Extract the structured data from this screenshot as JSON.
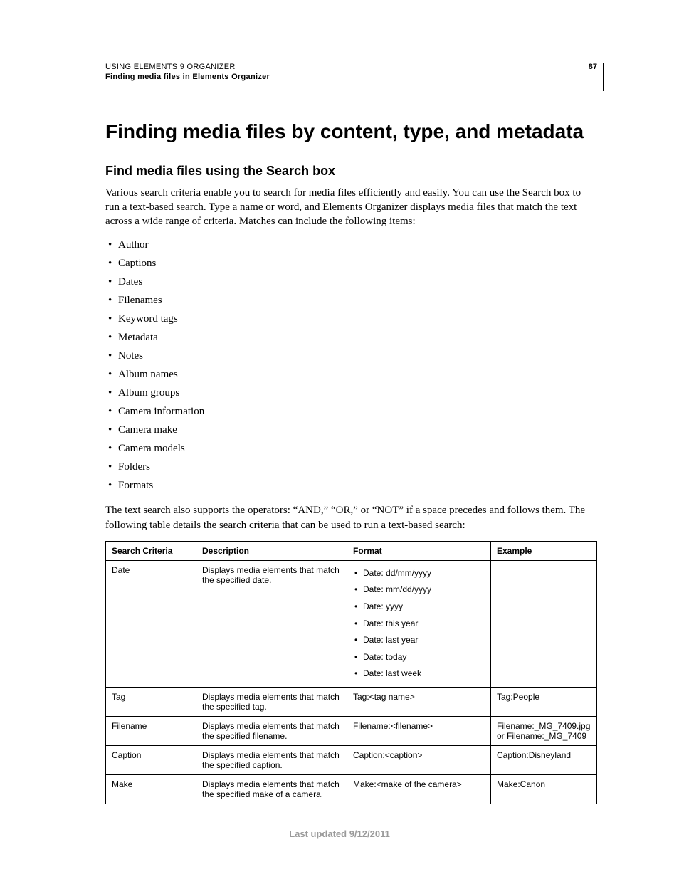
{
  "header": {
    "doc_title": "USING ELEMENTS 9 ORGANIZER",
    "section_path": "Finding media files in Elements Organizer",
    "page_number": "87"
  },
  "chapter_title": "Finding media files by content, type, and metadata",
  "section_title": "Find media files using the Search box",
  "intro_para": "Various search criteria enable you to search for media files efficiently and easily. You can use the Search box to run a text-based search. Type a name or word, and Elements Organizer displays media files that match the text across a wide range of criteria. Matches can include the following items:",
  "criteria_list": [
    "Author",
    "Captions",
    "Dates",
    "Filenames",
    "Keyword tags",
    "Metadata",
    "Notes",
    "Album names",
    "Album groups",
    "Camera information",
    "Camera make",
    "Camera models",
    "Folders",
    "Formats"
  ],
  "post_list_para": "The text search also supports the operators: “AND,” “OR,” or “NOT” if a space precedes and follows them. The following table details the search criteria that can be used to run a text-based search:",
  "table": {
    "headers": [
      "Search Criteria",
      "Description",
      "Format",
      "Example"
    ],
    "rows": [
      {
        "criteria": "Date",
        "description": "Displays media elements that match the specified date.",
        "format_list": [
          "Date: dd/mm/yyyy",
          "Date: mm/dd/yyyy",
          "Date: yyyy",
          "Date: this year",
          "Date: last year",
          "Date: today",
          "Date: last week"
        ],
        "example": ""
      },
      {
        "criteria": "Tag",
        "description": "Displays media elements that match the specified tag.",
        "format": "Tag:<tag name>",
        "example": "Tag:People"
      },
      {
        "criteria": "Filename",
        "description": "Displays media elements that match the specified filename.",
        "format": "Filename:<filename>",
        "example": "Filename:_MG_7409.jpg or Filename:_MG_7409"
      },
      {
        "criteria": "Caption",
        "description": "Displays media elements that match the specified caption.",
        "format": "Caption:<caption>",
        "example": "Caption:Disneyland"
      },
      {
        "criteria": "Make",
        "description": "Displays media elements that match the specified make of a camera.",
        "format": "Make:<make of the camera>",
        "example": "Make:Canon"
      }
    ]
  },
  "footer": "Last updated 9/12/2011"
}
